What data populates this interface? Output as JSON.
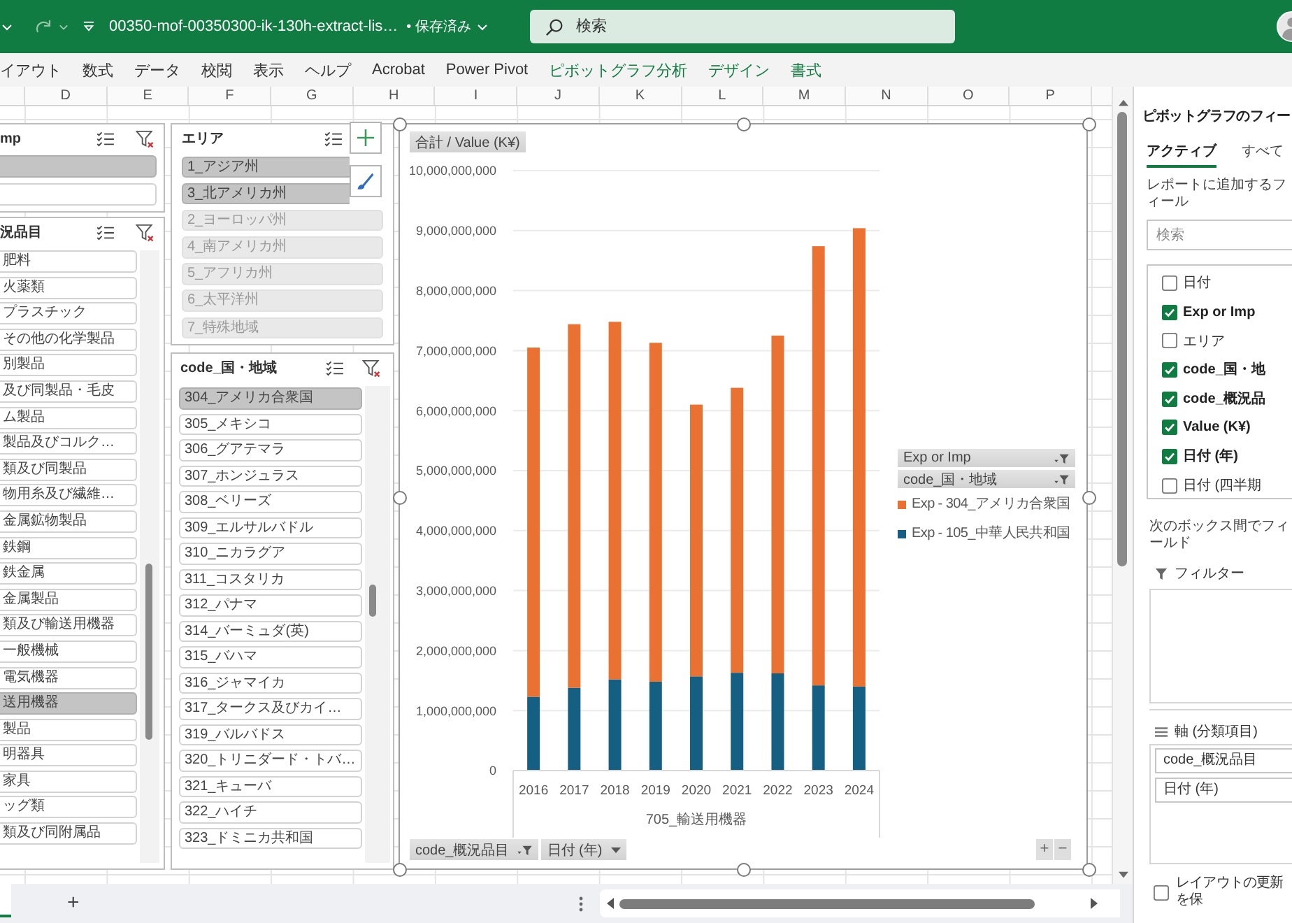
{
  "title_bar": {
    "filename": "00350-mof-00350300-ik-130h-extract-lis…",
    "save_status": "• 保存済み",
    "search": {
      "placeholder": "検索"
    }
  },
  "ribbon_tabs": [
    {
      "label": "イアウト",
      "kind": "standard"
    },
    {
      "label": "数式",
      "kind": "standard"
    },
    {
      "label": "データ",
      "kind": "standard"
    },
    {
      "label": "校閲",
      "kind": "standard"
    },
    {
      "label": "表示",
      "kind": "standard"
    },
    {
      "label": "ヘルプ",
      "kind": "standard"
    },
    {
      "label": "Acrobat",
      "kind": "standard"
    },
    {
      "label": "Power Pivot",
      "kind": "standard"
    },
    {
      "label": "ピボットグラフ分析",
      "kind": "contextual"
    },
    {
      "label": "デザイン",
      "kind": "contextual"
    },
    {
      "label": "書式",
      "kind": "contextual"
    }
  ],
  "column_headers": [
    "D",
    "E",
    "F",
    "G",
    "H",
    "I",
    "J",
    "K",
    "L",
    "M",
    "N",
    "O",
    "P"
  ],
  "slicers": [
    {
      "title": "mp",
      "items": [
        {
          "selected": true
        },
        {
          "selected": false
        }
      ]
    },
    {
      "title": "況品目",
      "items": [
        {
          "label": "肥料",
          "selected": false
        },
        {
          "label": "火薬類",
          "selected": false
        },
        {
          "label": "プラスチック",
          "selected": false
        },
        {
          "label": "その他の化学製品",
          "selected": false
        },
        {
          "label": "別製品",
          "selected": false
        },
        {
          "label": "及び同製品・毛皮",
          "selected": false
        },
        {
          "label": "ム製品",
          "selected": false
        },
        {
          "label": "製品及びコルク…",
          "selected": false
        },
        {
          "label": "類及び同製品",
          "selected": false
        },
        {
          "label": "物用糸及び繊維…",
          "selected": false
        },
        {
          "label": "金属鉱物製品",
          "selected": false
        },
        {
          "label": "鉄鋼",
          "selected": false
        },
        {
          "label": "鉄金属",
          "selected": false
        },
        {
          "label": "金属製品",
          "selected": false
        },
        {
          "label": "類及び輸送用機器",
          "selected": false
        },
        {
          "label": "一般機械",
          "selected": false
        },
        {
          "label": "電気機器",
          "selected": false
        },
        {
          "label": "送用機器",
          "selected": true
        },
        {
          "label": "製品",
          "selected": false
        },
        {
          "label": "明器具",
          "selected": false
        },
        {
          "label": "家具",
          "selected": false
        },
        {
          "label": "ッグ類",
          "selected": false
        },
        {
          "label": "類及び同附属品",
          "selected": false
        }
      ]
    },
    {
      "title": "エリア",
      "items": [
        {
          "label": "1_アジア州",
          "selected": true,
          "dimmed": false
        },
        {
          "label": "3_北アメリカ州",
          "selected": true,
          "dimmed": false
        },
        {
          "label": "2_ヨーロッパ州",
          "selected": false,
          "dimmed": true
        },
        {
          "label": "4_南アメリカ州",
          "selected": false,
          "dimmed": true
        },
        {
          "label": "5_アフリカ州",
          "selected": false,
          "dimmed": true
        },
        {
          "label": "6_太平洋州",
          "selected": false,
          "dimmed": true
        },
        {
          "label": "7_特殊地域",
          "selected": false,
          "dimmed": true
        }
      ]
    },
    {
      "title": "code_国・地域",
      "items": [
        {
          "label": "304_アメリカ合衆国",
          "selected": true
        },
        {
          "label": "305_メキシコ",
          "selected": false
        },
        {
          "label": "306_グアテマラ",
          "selected": false
        },
        {
          "label": "307_ホンジュラス",
          "selected": false
        },
        {
          "label": "308_ベリーズ",
          "selected": false
        },
        {
          "label": "309_エルサルバドル",
          "selected": false
        },
        {
          "label": "310_ニカラグア",
          "selected": false
        },
        {
          "label": "311_コスタリカ",
          "selected": false
        },
        {
          "label": "312_パナマ",
          "selected": false
        },
        {
          "label": "314_バーミュダ(英)",
          "selected": false
        },
        {
          "label": "315_バハマ",
          "selected": false
        },
        {
          "label": "316_ジャマイカ",
          "selected": false
        },
        {
          "label": "317_タークス及びカイ…",
          "selected": false
        },
        {
          "label": "319_バルバドス",
          "selected": false
        },
        {
          "label": "320_トリニダード・トバ…",
          "selected": false
        },
        {
          "label": "321_キューバ",
          "selected": false
        },
        {
          "label": "322_ハイチ",
          "selected": false
        },
        {
          "label": "323_ドミニカ共和国",
          "selected": false
        }
      ]
    }
  ],
  "chart": {
    "value_field": "合計 / Value (K¥)",
    "legend_fields": [
      {
        "label": "Exp or Imp",
        "filtered": true
      },
      {
        "label": "code_国・地域",
        "filtered": true
      }
    ],
    "axis_fields": [
      {
        "label": "code_概況品目",
        "filtered": true
      },
      {
        "label": "日付 (年)",
        "filtered": false
      }
    ],
    "zoom_buttons": [
      "+",
      "−"
    ],
    "chart_data": {
      "type": "bar",
      "stacked": true,
      "grid": true,
      "categories": [
        "2016",
        "2017",
        "2018",
        "2019",
        "2020",
        "2021",
        "2022",
        "2023",
        "2024"
      ],
      "xlabel": "705_輸送用機器",
      "ylim": [
        0,
        10000000000
      ],
      "yticks": [
        0,
        {
          "value": 1000000000,
          "label": "1,000,000,000"
        },
        {
          "value": 2000000000,
          "label": "2,000,000,000"
        },
        {
          "value": 3000000000,
          "label": "3,000,000,000"
        },
        {
          "value": 4000000000,
          "label": "4,000,000,000"
        },
        {
          "value": 5000000000,
          "label": "5,000,000,000"
        },
        {
          "value": 6000000000,
          "label": "6,000,000,000"
        },
        {
          "value": 7000000000,
          "label": "7,000,000,000"
        },
        {
          "value": 8000000000,
          "label": "8,000,000,000"
        },
        {
          "value": 9000000000,
          "label": "9,000,000,000"
        },
        {
          "value": 10000000000,
          "label": "10,000,000,000"
        }
      ],
      "series": [
        {
          "name": "Exp - 105_中華人民共和国",
          "color": "#156082",
          "values": [
            1230000000,
            1380000000,
            1520000000,
            1480000000,
            1570000000,
            1630000000,
            1620000000,
            1420000000,
            1400000000
          ]
        },
        {
          "name": "Exp - 304_アメリカ合衆国",
          "color": "#e97132",
          "values": [
            5820000000,
            6060000000,
            5960000000,
            5650000000,
            4530000000,
            4750000000,
            5630000000,
            7320000000,
            7640000000
          ]
        }
      ]
    }
  },
  "field_pane": {
    "title": "ピボットグラフのフィー",
    "tabs": [
      {
        "label": "アクティブ",
        "selected": true
      },
      {
        "label": "すべて",
        "selected": false
      }
    ],
    "instruction": "レポートに追加するフィール",
    "search": {
      "placeholder": "検索"
    },
    "fields": [
      {
        "label": "日付",
        "checked": false
      },
      {
        "label": "Exp or Imp",
        "checked": true
      },
      {
        "label": "エリア",
        "checked": false
      },
      {
        "label": "code_国・地",
        "checked": true
      },
      {
        "label": "code_概況品",
        "checked": true
      },
      {
        "label": "Value (K¥)",
        "checked": true
      },
      {
        "label": "日付 (年)",
        "checked": true
      },
      {
        "label": "日付 (四半期",
        "checked": false
      }
    ],
    "areas_hint": "次のボックス間でフィールド",
    "filter_area": {
      "title": "フィルター"
    },
    "axis_area": {
      "title": "軸 (分類項目)",
      "items": [
        "code_概況品目",
        "日付 (年)"
      ]
    },
    "defer_update": {
      "label": "レイアウトの更新を保",
      "checked": false
    }
  },
  "sheet_bar": {
    "add_sheet": "+"
  }
}
